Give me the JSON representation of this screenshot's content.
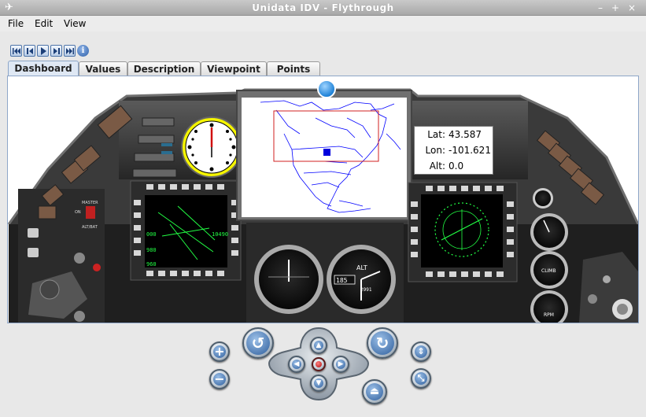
{
  "window": {
    "title": "Unidata IDV - Flythrough",
    "app_icon": "airplane-icon",
    "buttons": [
      "minimize-icon",
      "maximize-icon",
      "close-icon"
    ]
  },
  "menubar": {
    "items": [
      "File",
      "Edit",
      "View"
    ]
  },
  "animation": {
    "buttons": [
      "first-frame-icon",
      "step-back-icon",
      "play-icon",
      "step-forward-icon",
      "last-frame-icon",
      "info-icon"
    ],
    "info_glyph": "i"
  },
  "tabs": [
    "Dashboard",
    "Values",
    "Description",
    "Viewpoint",
    "Points"
  ],
  "active_tab": "Dashboard",
  "readout": {
    "lat_label": "Lat:",
    "lat_value": "43.587",
    "lon_label": "Lon:",
    "lon_value": "-101.621",
    "alt_label": "Alt:",
    "alt_value": "0.0"
  },
  "cockpit": {
    "master_label": "MASTER",
    "on_label": "ON",
    "alt_label": "ALT/BAT",
    "climb_label": "CLIMB",
    "rpm_label": "RPM",
    "altimeter_label": "ALT",
    "altimeter_digits": "185",
    "altimeter_sub": "2991",
    "hud_left_values": [
      "000",
      "980",
      "960"
    ],
    "hud_right_value": "10490"
  },
  "colors": {
    "accent": "#3d6fb0",
    "map_lines": "#0000ff",
    "bbox": "#d02020",
    "hud_green": "#22ff44",
    "compass_ring": "#f5f500"
  },
  "navigation": {
    "buttons": [
      "zoom-in-icon",
      "zoom-out-icon",
      "rotate-left-icon",
      "rotate-right-icon",
      "pan-up-icon",
      "pan-left-icon",
      "center-icon",
      "pan-right-icon",
      "pan-down-icon",
      "reset-icon",
      "eject-icon",
      "fit-icon"
    ]
  }
}
